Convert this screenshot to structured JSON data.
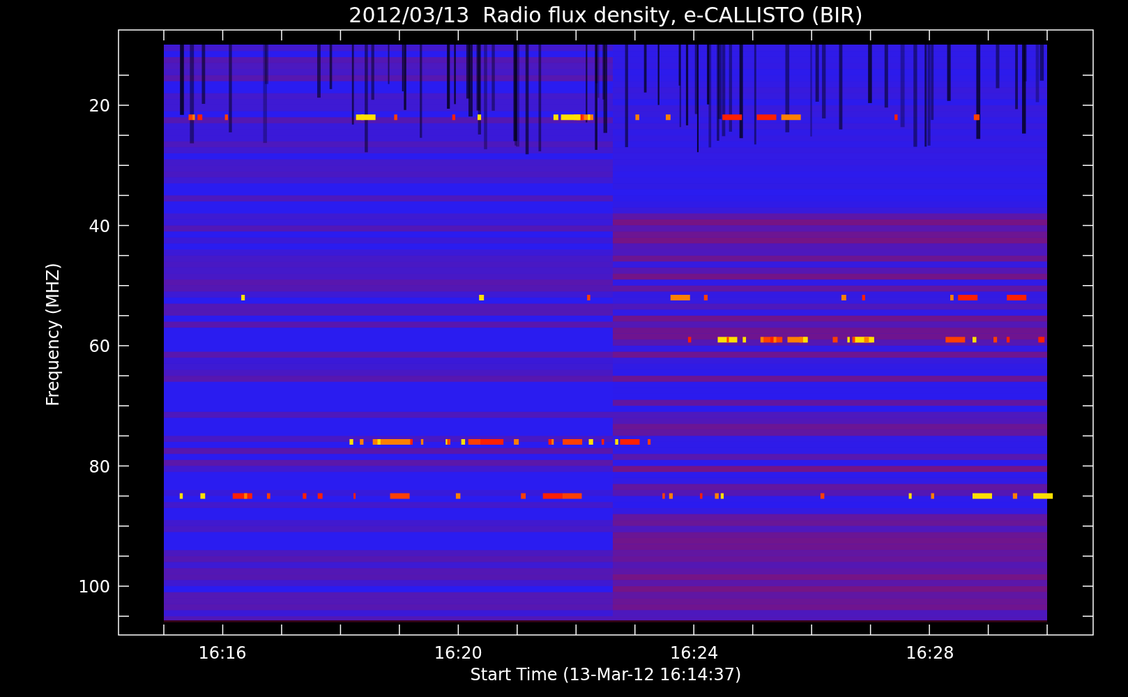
{
  "plot": {
    "title": "2012/03/13  Radio flux density, e-CALLISTO (BIR)",
    "ylabel": "Frequency (MHZ)",
    "xlabel": "Start Time (13-Mar-12 16:14:37)",
    "yticks": [
      "20",
      "40",
      "60",
      "80",
      "100"
    ],
    "xticks": [
      "16:16",
      "16:20",
      "16:24",
      "16:28"
    ]
  }
}
